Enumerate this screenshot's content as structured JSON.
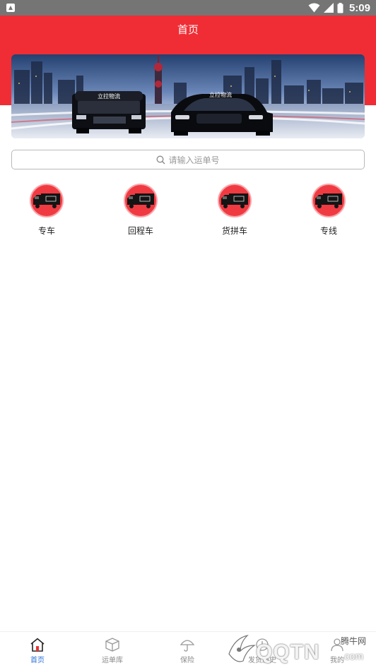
{
  "status_bar": {
    "time": "5:09"
  },
  "header": {
    "title": "首页"
  },
  "banner": {
    "truck_sign": "立拉物流",
    "car_sign": "立拉物流"
  },
  "search": {
    "placeholder": "请输入运单号"
  },
  "categories": [
    {
      "label": "专车",
      "icon": "truck-icon"
    },
    {
      "label": "回程车",
      "icon": "truck-icon"
    },
    {
      "label": "货拼车",
      "icon": "truck-icon"
    },
    {
      "label": "专线",
      "icon": "truck-icon"
    }
  ],
  "bottom_nav": [
    {
      "label": "首页",
      "icon": "home-icon",
      "active": true
    },
    {
      "label": "运单库",
      "icon": "box-icon",
      "active": false
    },
    {
      "label": "保险",
      "icon": "umbrella-icon",
      "active": false
    },
    {
      "label": "发货历史",
      "icon": "history-icon",
      "active": false
    },
    {
      "label": "我的",
      "icon": "person-icon",
      "active": false
    }
  ],
  "watermark": {
    "site_cn": "腾牛网",
    "brand": "QQTN",
    "suffix": ".com"
  },
  "colors": {
    "header_red": "#f02d35",
    "active_blue": "#2b73d8",
    "status_gray": "#757575"
  }
}
